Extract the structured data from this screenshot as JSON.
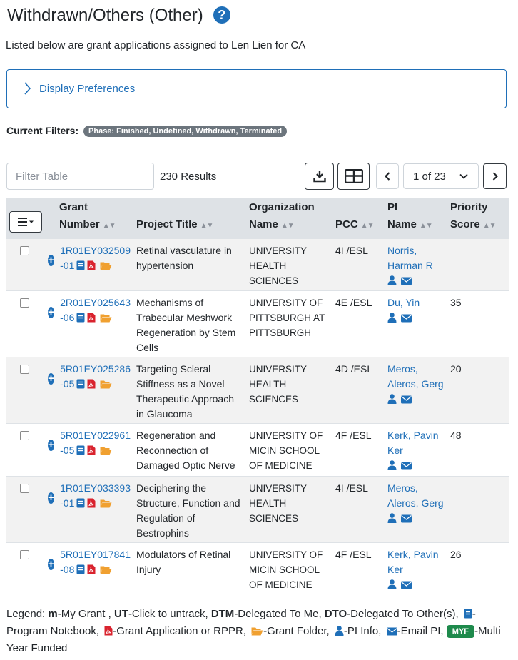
{
  "page": {
    "title": "Withdrawn/Others (Other)",
    "subtitle": "Listed below are grant applications assigned to Len Lien for CA"
  },
  "preferences": {
    "label": "Display Preferences"
  },
  "filters": {
    "label": "Current Filters:",
    "badge": "Phase: Finished, Undefined, Withdrawn, Terminated"
  },
  "toolbar": {
    "filter_placeholder": "Filter Table",
    "results": "230 Results",
    "page_indicator": "1 of 23"
  },
  "table": {
    "headers": {
      "grant_number_1": "Grant",
      "grant_number_2": "Number",
      "project_title": "Project Title",
      "organization_1": "Organization",
      "organization_2": "Name",
      "pcc": "PCC",
      "pi_1": "PI",
      "pi_2": "Name",
      "priority_1": "Priority",
      "priority_2": "Score"
    },
    "rows": [
      {
        "grant_line1": "1R01EY032509",
        "grant_line2": "-01",
        "title": "Retinal vasculature in hypertension",
        "org": "UNIVERSITY HEALTH SCIENCES",
        "pcc": "4I /ESL",
        "pi": "Norris, Harman R",
        "score": ""
      },
      {
        "grant_line1": "2R01EY025643",
        "grant_line2": "-06",
        "title": "Mechanisms of Trabecular Meshwork Regeneration by Stem Cells",
        "org": "UNIVERSITY OF PITTSBURGH AT PITTSBURGH",
        "pcc": "4E /ESL",
        "pi": "Du, Yin",
        "score": "35"
      },
      {
        "grant_line1": "5R01EY025286",
        "grant_line2": "-05",
        "title": "Targeting Scleral Stiffness as a Novel Therapeutic Approach in Glaucoma",
        "org": "UNIVERSITY HEALTH SCIENCES",
        "pcc": "4D /ESL",
        "pi": "Meros, Aleros, Gerg",
        "score": "20"
      },
      {
        "grant_line1": "5R01EY022961",
        "grant_line2": "-05",
        "title": "Regeneration and Reconnection of Damaged Optic Nerve",
        "org": "UNIVERSITY OF MICIN SCHOOL OF MEDICINE",
        "pcc": "4F /ESL",
        "pi": "Kerk, Pavin Ker",
        "score": "48"
      },
      {
        "grant_line1": "1R01EY033393",
        "grant_line2": "-01",
        "title": "Deciphering the Structure, Function and Regulation of Bestrophins",
        "org": "UNIVERSITY HEALTH SCIENCES",
        "pcc": "4I /ESL",
        "pi": "Meros, Aleros, Gerg",
        "score": ""
      },
      {
        "grant_line1": "5R01EY017841",
        "grant_line2": "-08",
        "title": "Modulators of Retinal Injury",
        "org": "UNIVERSITY OF MICIN SCHOOL OF MEDICINE",
        "pcc": "4F /ESL",
        "pi": "Kerk, Pavin Ker",
        "score": "26"
      }
    ]
  },
  "legend": {
    "prefix": "Legend:",
    "m_key": "m",
    "m_text": "-My Grant ,",
    "ut_key": "UT",
    "ut_text": "-Click to untrack,",
    "dtm_key": "DTM",
    "dtm_text": "-Delegated To Me,",
    "dto_key": "DTO",
    "dto_text": "-Delegated To Other(s),",
    "notebook_text": "-Program Notebook,",
    "pdf_text": "-Grant Application or RPPR,",
    "folder_text": "-Grant Folder,",
    "pi_text": "-PI Info,",
    "email_text": "-Email PI,",
    "myf_badge": "MYF",
    "myf_text": "-Multi Year Funded"
  },
  "colors": {
    "link": "#1f6fb8",
    "pdf": "#d9232e",
    "folder": "#f0a030",
    "badge_gray": "#6c757d",
    "myf_green": "#1e8a4c",
    "header_bg": "#dee2e6"
  }
}
